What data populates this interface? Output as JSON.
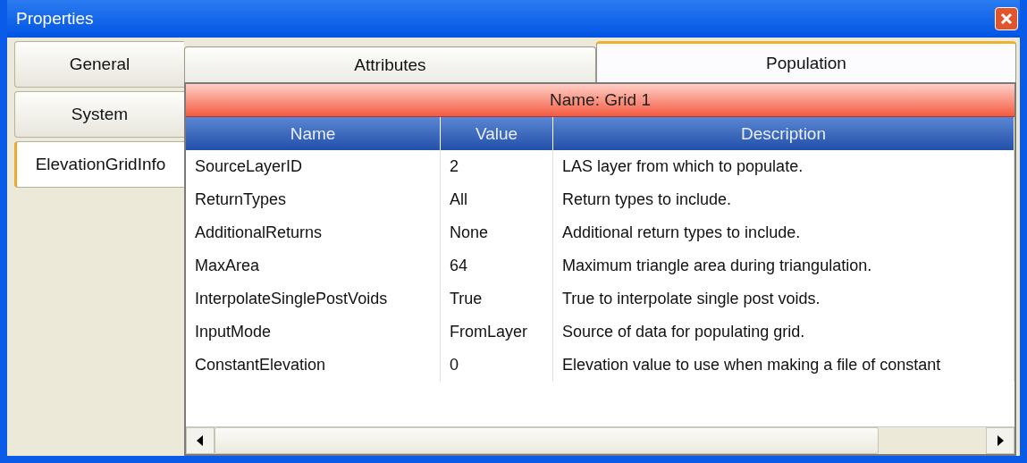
{
  "window": {
    "title": "Properties"
  },
  "side_tabs": [
    {
      "label": "General",
      "selected": false
    },
    {
      "label": "System",
      "selected": false
    },
    {
      "label": "ElevationGridInfo",
      "selected": true
    }
  ],
  "tabs": [
    {
      "label": "Attributes",
      "selected": false
    },
    {
      "label": "Population",
      "selected": true
    }
  ],
  "name_bar": "Name: Grid 1",
  "table": {
    "columns": [
      "Name",
      "Value",
      "Description"
    ],
    "rows": [
      [
        "SourceLayerID",
        "2",
        "LAS layer from which to populate."
      ],
      [
        "ReturnTypes",
        "All",
        "Return types to include."
      ],
      [
        "AdditionalReturns",
        "None",
        "Additional return types to include."
      ],
      [
        "MaxArea",
        "64",
        "Maximum triangle area during triangulation."
      ],
      [
        "InterpolateSinglePostVoids",
        "True",
        "True to interpolate single post voids."
      ],
      [
        "InputMode",
        "FromLayer",
        "Source of data for populating grid."
      ],
      [
        "ConstantElevation",
        "0",
        "Elevation value to use when making a file of constant"
      ]
    ]
  }
}
